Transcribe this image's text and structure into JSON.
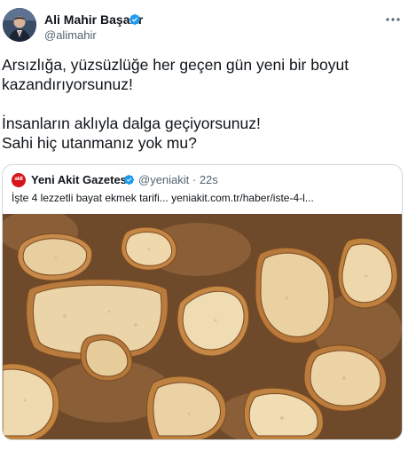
{
  "author": {
    "name": "Ali Mahir Başarır",
    "handle": "@alimahir"
  },
  "tweet": {
    "lines": [
      "Arsızlığa, yüzsüzlüğe her geçen gün yeni bir boyut",
      "kazandırıyorsunuz!",
      "İnsanların aklıyla dalga geçiyorsunuz!",
      "Sahi hiç utanmanız yok mu?"
    ]
  },
  "quote": {
    "logo_text": "akit",
    "name": "Yeni Akit Gazetesi",
    "handle_time": "@yeniakit · 22s",
    "text": "İşte 4 lezzetli bayat ekmek tarifi... yeniakit.com.tr/haber/iste-4-l..."
  },
  "icons": {
    "verified": "verified-badge-icon",
    "more": "more-options-icon"
  },
  "colors": {
    "verified": "#1d9bf0",
    "secondary_text": "#536471",
    "border": "#cfd9de",
    "akit_red": "#d7141a"
  }
}
